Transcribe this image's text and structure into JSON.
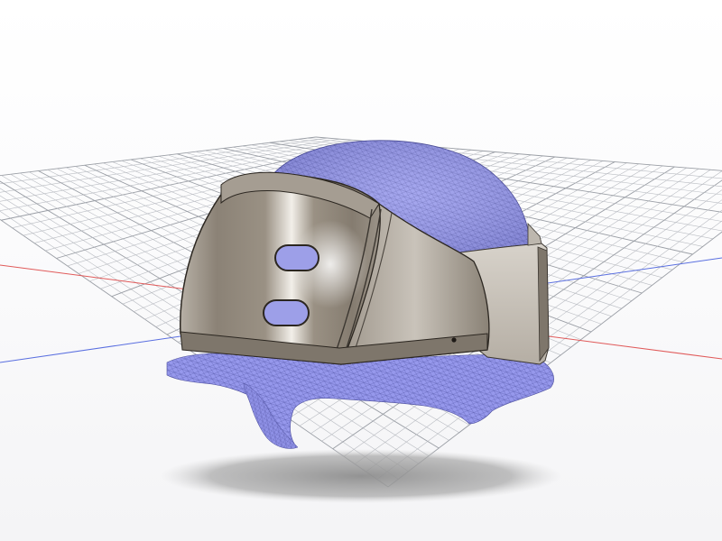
{
  "viewport": {
    "background": "#ffffff",
    "ground_grid": {
      "line_color": "#b9bcc2",
      "x_axis_color": "#e05a5a",
      "z_axis_color": "#5a6fe0"
    }
  },
  "model": {
    "helmet_shell": {
      "color": "#8d8478",
      "highlight": "#e8e4dc",
      "vents": 2
    },
    "scan_mesh": {
      "color": "#8c8ee8",
      "wire_color": "#4a4c9a"
    },
    "shadow_color": "#9a9a9a"
  }
}
